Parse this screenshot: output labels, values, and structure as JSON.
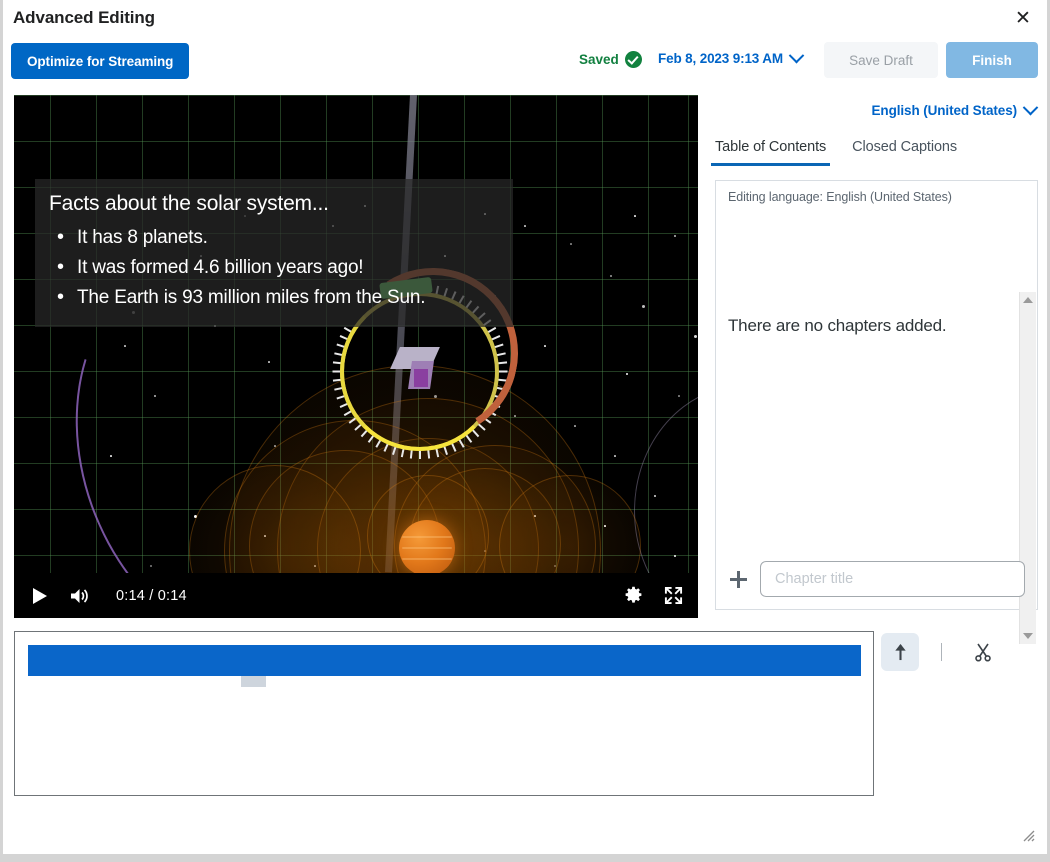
{
  "window": {
    "title": "Advanced Editing",
    "close_icon": "close-icon",
    "resize_grip_icon": "resize-grip-icon"
  },
  "toolbar": {
    "optimize_label": "Optimize for Streaming",
    "saved_label": "Saved",
    "saved_icon": "check-circle-icon",
    "date_label": "Feb 8, 2023 9:13 AM",
    "date_chevron_icon": "chevron-down-icon",
    "save_draft_label": "Save Draft",
    "finish_label": "Finish"
  },
  "colors": {
    "primary_blue": "#0067c5",
    "link_blue": "#0064c8",
    "finish_blue": "#81b8e3",
    "saved_green": "#128040",
    "track_blue": "#0a66c9",
    "tab_underline": "#0a66b5",
    "marker_gray": "#ced5dd"
  },
  "video": {
    "caption": {
      "title": "Facts about the solar system...",
      "bullets": [
        "It has 8 planets.",
        "It was formed 4.6 billion years ago!",
        "The Earth is 93 million miles from the Sun."
      ]
    },
    "controls": {
      "play_icon": "play-icon",
      "volume_icon": "volume-icon",
      "time_display": "0:14 / 0:14",
      "current_time": "0:14",
      "duration": "0:14",
      "settings_icon": "gear-icon",
      "fullscreen_icon": "fullscreen-icon"
    }
  },
  "right_panel": {
    "language_label": "English (United States)",
    "language_chevron_icon": "chevron-down-icon",
    "tabs": [
      {
        "label": "Table of Contents",
        "active": true
      },
      {
        "label": "Closed Captions",
        "active": false
      }
    ],
    "editing_language": "Editing language: English (United States)",
    "empty_message": "There are no chapters added.",
    "add_chapter": {
      "plus_icon": "plus-icon",
      "placeholder": "Chapter title",
      "value": ""
    },
    "scrollbar": {
      "up_icon": "scroll-up-arrow-icon",
      "down_icon": "scroll-down-arrow-icon"
    }
  },
  "timeline": {
    "tools": {
      "upload_icon": "arrow-up-icon",
      "cut_icon": "scissors-icon"
    }
  }
}
